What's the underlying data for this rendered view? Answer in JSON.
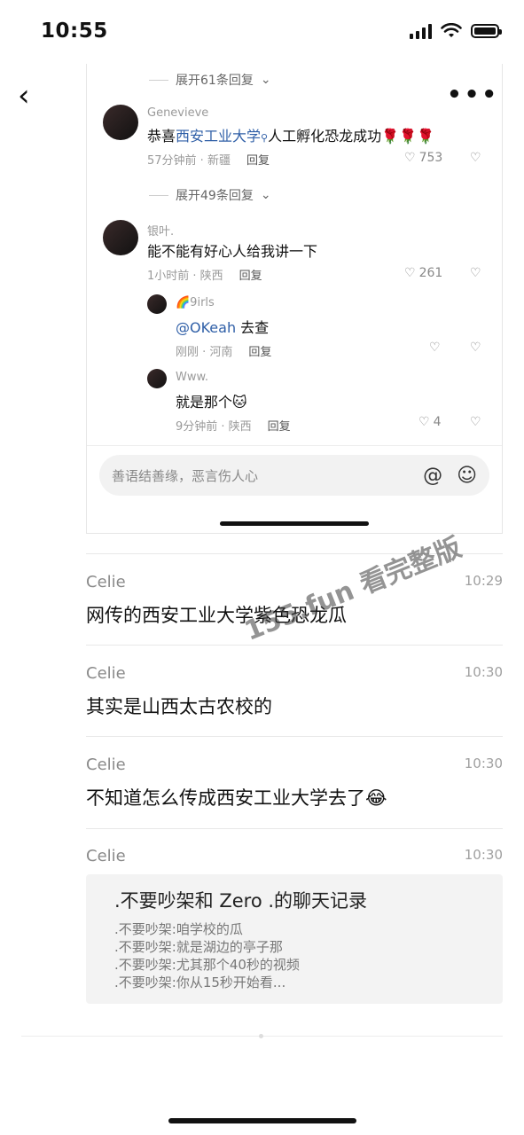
{
  "status": {
    "time": "10:55"
  },
  "nav": {
    "back_icon": "‹",
    "more_icon": "•••"
  },
  "card": {
    "expand1": "展开61条回复",
    "expand2": "展开49条回复",
    "comments": [
      {
        "user": "Genevieve",
        "pre": "恭喜",
        "link": "西安工业大学",
        "post": "人工孵化恐龙成功🌹🌹🌹",
        "meta_time": "57分钟前 · 新疆",
        "reply": "回复",
        "likes": "753"
      },
      {
        "user": "银叶.",
        "text": "能不能有好心人给我讲一下",
        "meta_time": "1小时前 · 陕西",
        "reply": "回复",
        "likes": "261"
      },
      {
        "user": "🌈9irls",
        "mention": "@OKeah",
        "text": " 去查",
        "meta_time": "刚刚 · 河南",
        "reply": "回复",
        "likes": ""
      },
      {
        "user": "Www.",
        "text": "就是那个🐱",
        "meta_time": "9分钟前 · 陕西",
        "reply": "回复",
        "likes": "4"
      }
    ],
    "input_placeholder": "善语结善缘，恶言伤人心",
    "at_icon": "@",
    "emoji_icon": "☺"
  },
  "messages": [
    {
      "sender": "Celie",
      "time": "10:29",
      "text": "网传的西安工业大学紫色恐龙瓜"
    },
    {
      "sender": "Celie",
      "time": "10:30",
      "text": "其实是山西太古农校的"
    },
    {
      "sender": "Celie",
      "time": "10:30",
      "text": "不知道怎么传成西安工业大学去了😂"
    },
    {
      "sender": "Celie",
      "time": "10:30"
    }
  ],
  "record": {
    "title": ".不要吵架和 Zero .的聊天记录",
    "lines": [
      ".不要吵架:咱学校的瓜",
      ".不要吵架:就是湖边的亭子那",
      ".不要吵架:尤其那个40秒的视频",
      ".不要吵架:你从15秒开始看..."
    ]
  },
  "watermark": "155.fun 看完整版"
}
